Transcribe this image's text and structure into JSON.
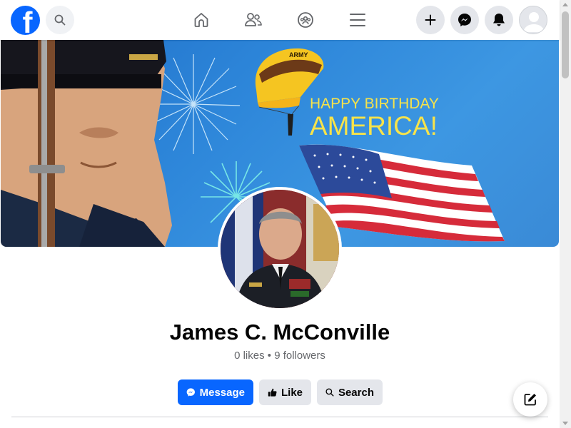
{
  "header": {
    "logo_letter": "f",
    "icons": {
      "search": "search-icon",
      "home": "home-icon",
      "friends": "friends-icon",
      "groups": "groups-icon",
      "menu": "menu-icon",
      "create": "plus-icon",
      "messenger": "messenger-icon",
      "notifications": "bell-icon",
      "account": "avatar-icon"
    }
  },
  "cover": {
    "line1": "HAPPY BIRTHDAY",
    "line2": "AMERICA!",
    "parachute_label": "ARMY"
  },
  "profile": {
    "name": "James C. McConville",
    "stats": "0 likes • 9 followers"
  },
  "actions": {
    "message_label": "Message",
    "like_label": "Like",
    "search_label": "Search"
  },
  "colors": {
    "brand": "#0866ff",
    "secondary_button": "#e4e6eb",
    "muted_text": "#65676b",
    "cover_text": "#f7e34a"
  }
}
